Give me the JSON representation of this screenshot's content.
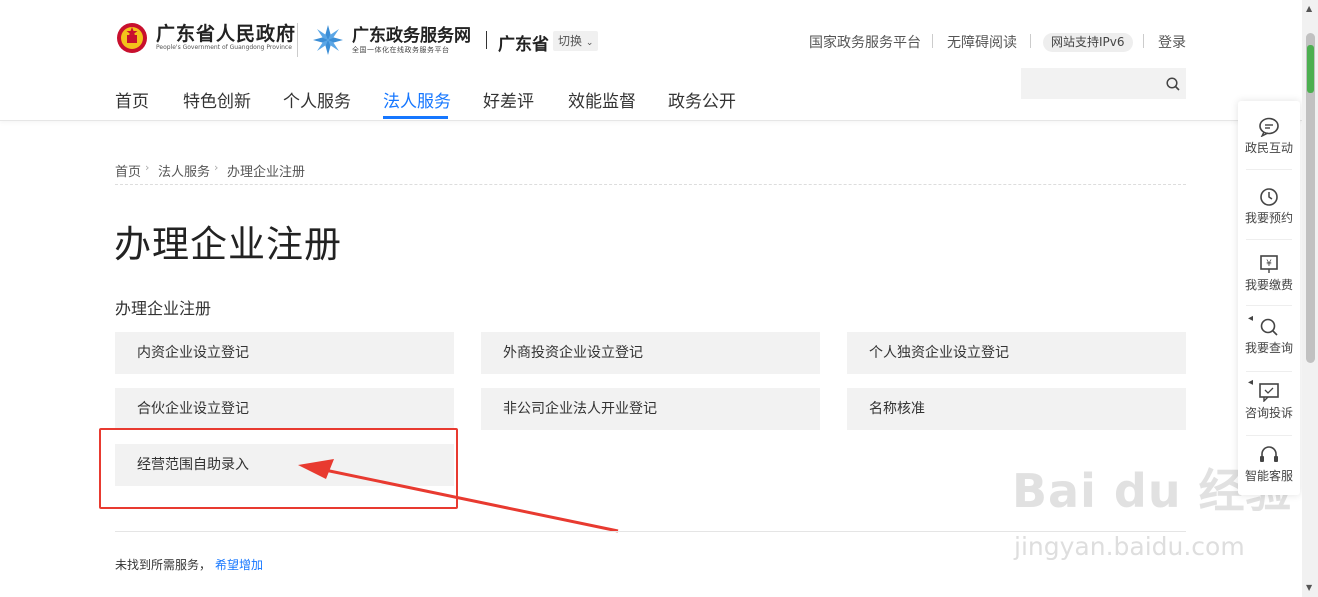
{
  "header": {
    "gov_name": "广东省人民政府",
    "gov_name_en": "People's Government of Guangdong Province",
    "service_name": "广东政务服务网",
    "service_sub": "全国一体化在线政务服务平台",
    "province": "广东省",
    "switch_label": "切换",
    "top_links": [
      "国家政务服务平台",
      "无障碍阅读",
      "网站支持IPv6",
      "登录"
    ],
    "search_placeholder": ""
  },
  "nav": {
    "items": [
      "首页",
      "特色创新",
      "个人服务",
      "法人服务",
      "好差评",
      "效能监督",
      "政务公开"
    ],
    "active": "法人服务"
  },
  "breadcrumb": [
    "首页",
    "法人服务",
    "办理企业注册"
  ],
  "main": {
    "title": "办理企业注册",
    "section_title": "办理企业注册",
    "services": [
      "内资企业设立登记",
      "外商投资企业设立登记",
      "个人独资企业设立登记",
      "合伙企业设立登记",
      "非公司企业法人开业登记",
      "名称核准",
      "经营范围自助录入"
    ],
    "footer_text": "未找到所需服务，",
    "footer_link": "希望增加"
  },
  "sidebar": {
    "items": [
      "政民互动",
      "我要预约",
      "我要缴费",
      "我要查询",
      "咨询投诉",
      "智能客服"
    ]
  },
  "watermark": {
    "brand": "Bai du 经验",
    "url": "jingyan.baidu.com"
  },
  "colors": {
    "accent": "#1677ff",
    "highlight": "#e83a30",
    "card_bg": "#f2f2f2"
  }
}
